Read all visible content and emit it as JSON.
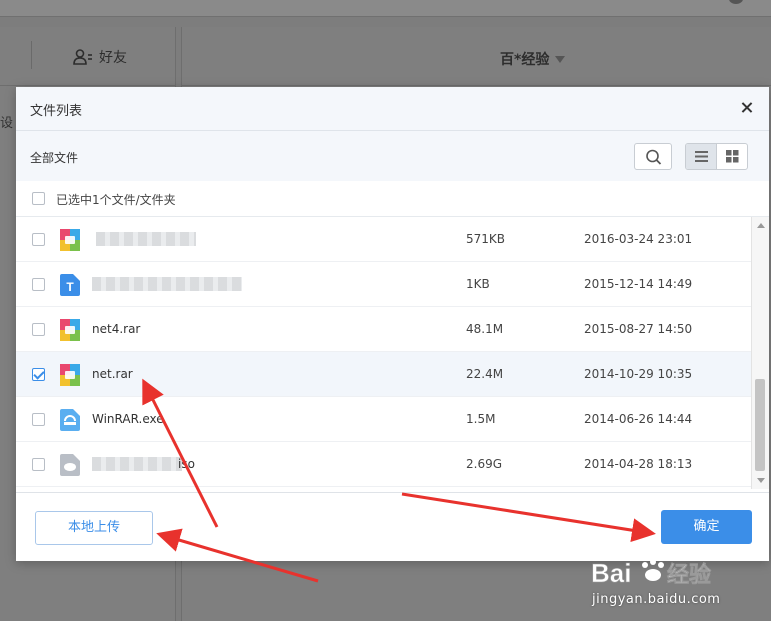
{
  "background": {
    "friends_label": "好友",
    "center_title": "百*经验",
    "settings_fragment": "设"
  },
  "dialog": {
    "title": "文件列表",
    "breadcrumb": "全部文件",
    "selection_summary": "已选中1个文件/文件夹",
    "view_mode": "list",
    "icons": [
      "close-icon",
      "search-icon",
      "list-view-icon",
      "grid-view-icon"
    ]
  },
  "files": [
    {
      "name": "",
      "obscured": true,
      "type": "archive",
      "size": "571KB",
      "modified": "2016-03-24 23:01",
      "checked": false
    },
    {
      "name": "",
      "obscured": true,
      "type": "text",
      "size": "1KB",
      "modified": "2015-12-14 14:49",
      "checked": false
    },
    {
      "name": "net4.rar",
      "obscured": false,
      "type": "archive",
      "size": "48.1M",
      "modified": "2015-08-27 14:50",
      "checked": false
    },
    {
      "name": "net.rar",
      "obscured": false,
      "type": "archive",
      "size": "22.4M",
      "modified": "2014-10-29 10:35",
      "checked": true
    },
    {
      "name": "WinRAR.exe",
      "obscured": false,
      "type": "exe",
      "size": "1.5M",
      "modified": "2014-06-26 14:44",
      "checked": false
    },
    {
      "name": "iso",
      "obscured": true,
      "type": "disk",
      "size": "2.69G",
      "modified": "2014-04-28 18:13",
      "checked": false
    }
  ],
  "buttons": {
    "local_upload": "本地上传",
    "confirm": "确定"
  },
  "colors": {
    "accent": "#3b8ee8",
    "annotation_arrow": "#e8322d",
    "overlay_dim": "#7d7d7d"
  },
  "watermark": {
    "brand": "Bai 经验",
    "url": "jingyan.baidu.com"
  }
}
